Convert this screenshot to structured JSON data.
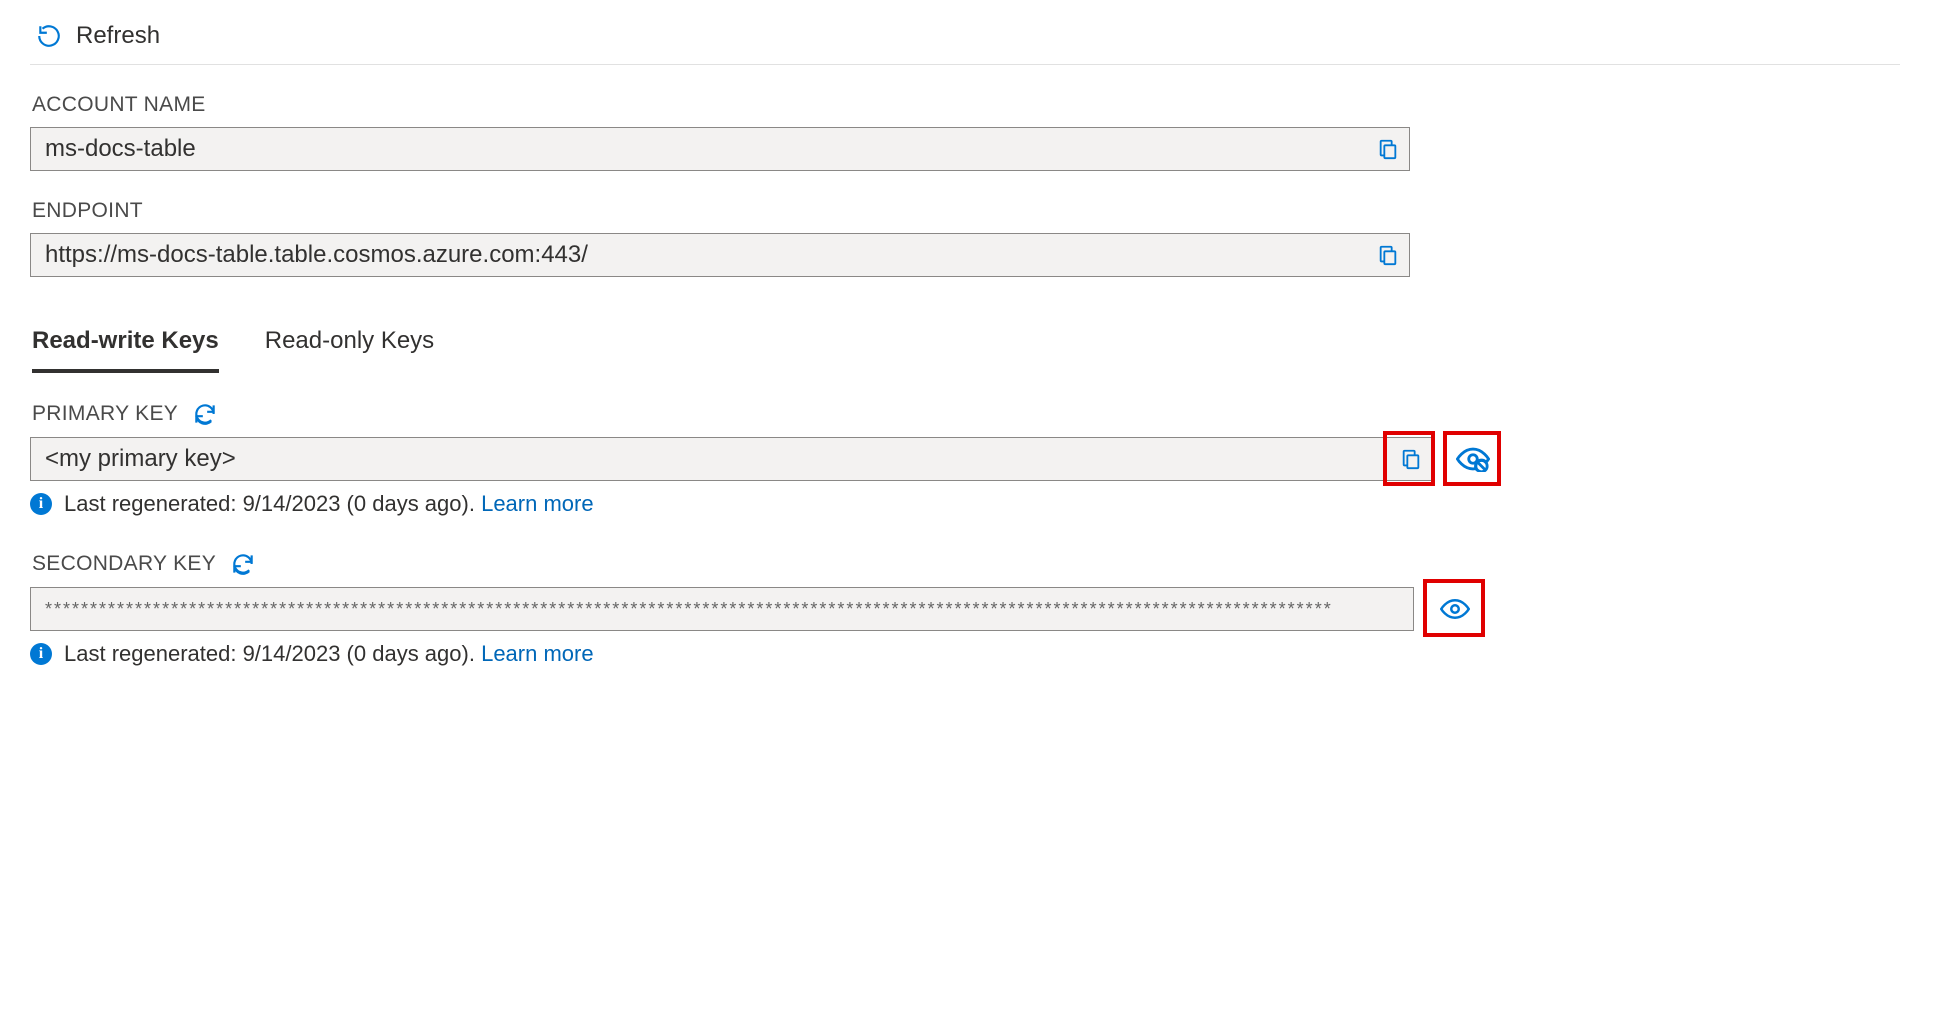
{
  "toolbar": {
    "refresh_label": "Refresh"
  },
  "fields": {
    "account_name": {
      "label": "ACCOUNT NAME",
      "value": "ms-docs-table"
    },
    "endpoint": {
      "label": "ENDPOINT",
      "value": "https://ms-docs-table.table.cosmos.azure.com:443/"
    }
  },
  "tabs": {
    "rw": "Read-write Keys",
    "ro": "Read-only Keys"
  },
  "keys": {
    "primary": {
      "label": "PRIMARY KEY",
      "value": "<my primary key>",
      "info_prefix": "Last regenerated: 9/14/2023 (0 days ago). ",
      "learn": "Learn more"
    },
    "secondary": {
      "label": "SECONDARY KEY",
      "value": "***********************************************************************************************************************************************",
      "info_prefix": "Last regenerated: 9/14/2023 (0 days ago). ",
      "learn": "Learn more"
    }
  }
}
